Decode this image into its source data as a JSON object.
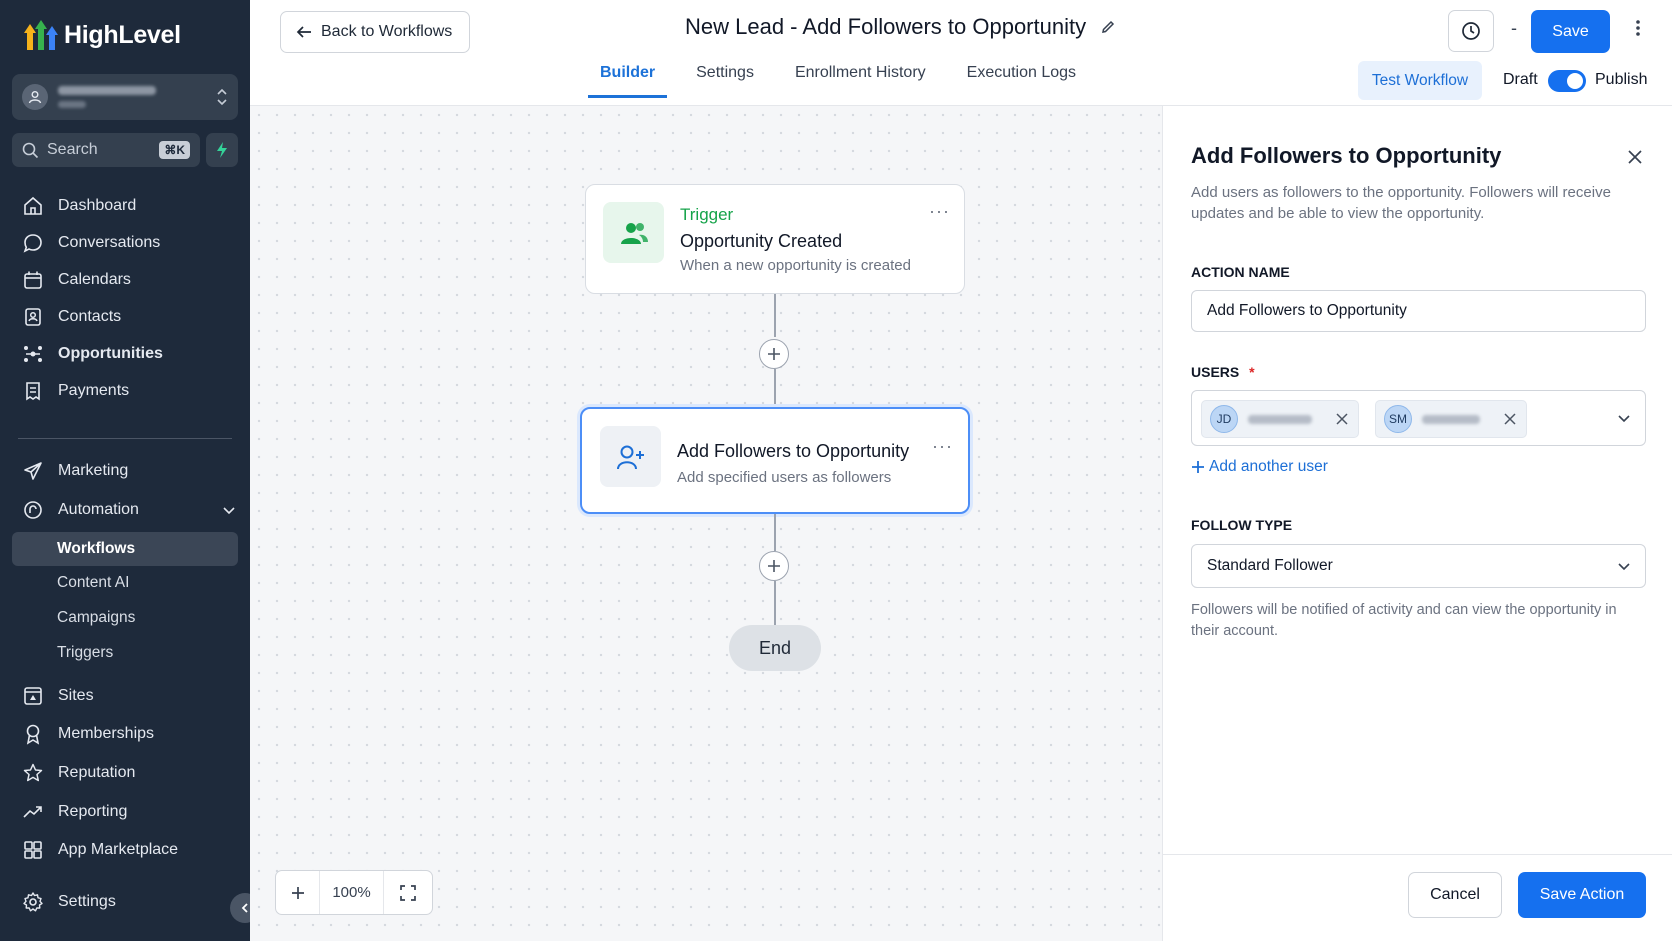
{
  "app": {
    "logo_text": "HighLevel"
  },
  "sidebar": {
    "search_label": "Search",
    "search_shortcut": "⌘K",
    "nav": [
      {
        "label": "Dashboard"
      },
      {
        "label": "Conversations"
      },
      {
        "label": "Calendars"
      },
      {
        "label": "Contacts"
      },
      {
        "label": "Opportunities"
      },
      {
        "label": "Payments"
      },
      {
        "label": "Marketing"
      },
      {
        "label": "Automation"
      },
      {
        "label": "Sites"
      },
      {
        "label": "Memberships"
      },
      {
        "label": "Reputation"
      },
      {
        "label": "Reporting"
      },
      {
        "label": "App Marketplace"
      },
      {
        "label": "Settings"
      }
    ],
    "automation_sub": [
      {
        "label": "Workflows"
      },
      {
        "label": "Content AI"
      },
      {
        "label": "Campaigns"
      },
      {
        "label": "Triggers"
      }
    ]
  },
  "header": {
    "back_label": "Back to Workflows",
    "title": "New Lead - Add Followers to Opportunity",
    "tabs": [
      {
        "label": "Builder"
      },
      {
        "label": "Settings"
      },
      {
        "label": "Enrollment History"
      },
      {
        "label": "Execution Logs"
      }
    ],
    "dash": "-",
    "save_label": "Save",
    "test_label": "Test Workflow",
    "draft_label": "Draft",
    "publish_label": "Publish"
  },
  "canvas": {
    "trigger": {
      "tag": "Trigger",
      "title": "Opportunity Created",
      "subtitle": "When a new opportunity is created"
    },
    "action": {
      "title": "Add Followers to Opportunity",
      "subtitle": "Add specified users as followers"
    },
    "end_label": "End",
    "zoom_level": "100%"
  },
  "panel": {
    "title": "Add Followers to Opportunity",
    "description": "Add users as followers to the opportunity. Followers will receive updates and be able to view the opportunity.",
    "action_name_label": "ACTION NAME",
    "action_name_value": "Add Followers to Opportunity",
    "users_label": "USERS",
    "required_mark": "*",
    "users": [
      {
        "initials": "JD"
      },
      {
        "initials": "SM"
      }
    ],
    "add_user_label": "Add another user",
    "follow_type_label": "FOLLOW TYPE",
    "follow_type_value": "Standard Follower",
    "follow_help": "Followers will be notified of activity and can view the opportunity in their account.",
    "cancel_label": "Cancel",
    "save_action_label": "Save Action"
  },
  "colors": {
    "sidebar_bg": "#1e2a3b",
    "primary": "#1570ef",
    "trigger_green": "#16a34a",
    "canvas_bg": "#f5f6f8"
  }
}
